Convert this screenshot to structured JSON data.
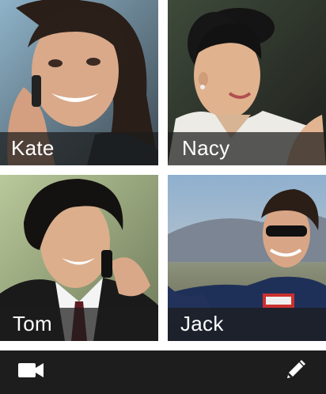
{
  "contacts": [
    {
      "name": "Kate"
    },
    {
      "name": "Nacy"
    },
    {
      "name": "Tom"
    },
    {
      "name": "Jack"
    }
  ],
  "toolbar": {
    "left_icon": "video-camera-icon",
    "right_icon": "pencil-icon"
  },
  "colors": {
    "label_overlay": "#1c1c1c",
    "toolbar_bg": "#1d1d1d",
    "icon": "#ffffff"
  }
}
